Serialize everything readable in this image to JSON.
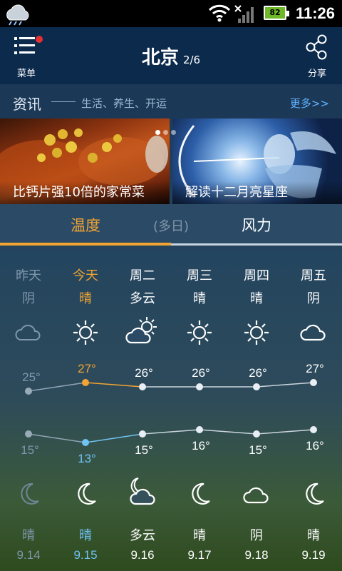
{
  "status_bar": {
    "time": "11:26",
    "battery": "82"
  },
  "header": {
    "menu_label": "菜单",
    "city": "北京",
    "page": "2/6",
    "share_label": "分享"
  },
  "news": {
    "title": "资讯",
    "subtitle": "生活、养生、开运",
    "more": "更多>>"
  },
  "banners": [
    {
      "caption": "比钙片强10倍的家常菜"
    },
    {
      "caption": "解读十二月亮星座"
    }
  ],
  "tabs": [
    {
      "label": "温度",
      "active": true
    },
    {
      "label": "(多日)",
      "active": false
    },
    {
      "label": "风力",
      "active": false
    }
  ],
  "forecast": [
    {
      "day": "昨天",
      "day_cond": "阴",
      "day_icon": "cloud-icon",
      "high": "25°",
      "low": "15°",
      "night_icon": "moon-icon",
      "night_cond": "晴",
      "date": "9.14"
    },
    {
      "day": "今天",
      "day_cond": "晴",
      "day_icon": "sun-icon",
      "high": "27°",
      "low": "13°",
      "night_icon": "moon-icon",
      "night_cond": "晴",
      "date": "9.15"
    },
    {
      "day": "周二",
      "day_cond": "多云",
      "day_icon": "sun-cloud-icon",
      "high": "26°",
      "low": "15°",
      "night_icon": "moon-cloud-icon",
      "night_cond": "多云",
      "date": "9.16"
    },
    {
      "day": "周三",
      "day_cond": "晴",
      "day_icon": "sun-icon",
      "high": "26°",
      "low": "16°",
      "night_icon": "moon-icon",
      "night_cond": "晴",
      "date": "9.17"
    },
    {
      "day": "周四",
      "day_cond": "晴",
      "day_icon": "sun-icon",
      "high": "26°",
      "low": "15°",
      "night_icon": "cloud-icon",
      "night_cond": "阴",
      "date": "9.18"
    },
    {
      "day": "周五",
      "day_cond": "阴",
      "day_icon": "cloud-icon",
      "high": "27°",
      "low": "16°",
      "night_icon": "moon-icon",
      "night_cond": "晴",
      "date": "9.19"
    }
  ],
  "chart_data": {
    "type": "line",
    "categories": [
      "昨天",
      "今天",
      "周二",
      "周三",
      "周四",
      "周五"
    ],
    "series": [
      {
        "values": [
          25,
          27,
          26,
          26,
          26,
          27
        ]
      },
      {
        "values": [
          15,
          13,
          15,
          16,
          15,
          16
        ]
      }
    ]
  },
  "colors": {
    "accent": "#f3a432",
    "today_low": "#6fc3f5",
    "header": "#0c2a4c"
  }
}
